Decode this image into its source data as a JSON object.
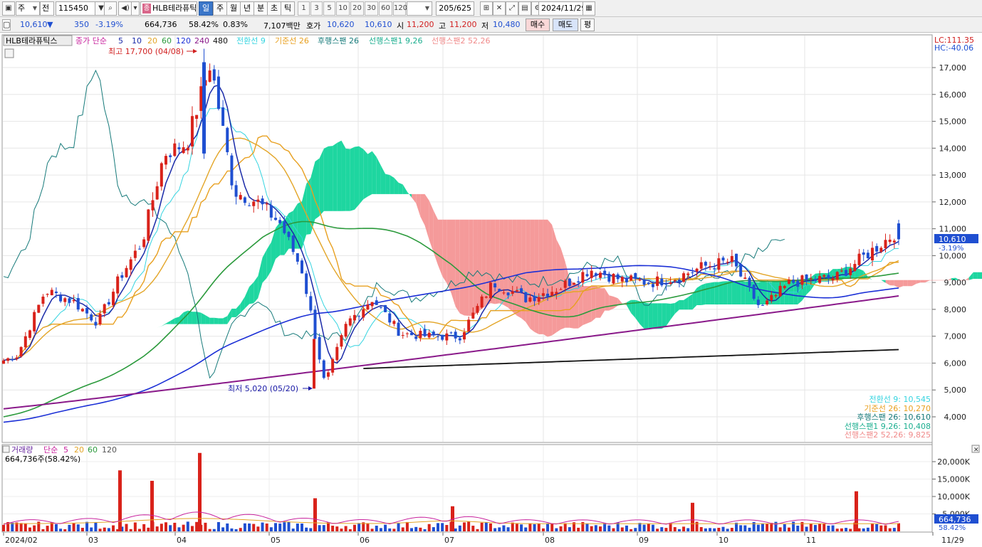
{
  "toolbar": {
    "period_type": "주",
    "market": "전",
    "code": "115450",
    "name": "HLB테라퓨틱",
    "name_tag": "종",
    "periods": [
      "일",
      "주",
      "월",
      "년",
      "분",
      "초",
      "틱"
    ],
    "active_period": "일",
    "numbers": [
      "1",
      "3",
      "5",
      "10",
      "20",
      "30",
      "60",
      "120"
    ],
    "count": "205/625",
    "date": "2024/11/29"
  },
  "quote": {
    "price": "10,610",
    "arrow": "▼",
    "change": "350",
    "change_pct": "-3.19%",
    "volume": "664,736",
    "vol_ratio": "58.42%",
    "turnover_pct": "0.83%",
    "amount": "7,107백만",
    "ask_label": "호가",
    "ask": "10,620",
    "bid": "10,610",
    "open_label": "시",
    "open": "11,200",
    "high_label": "고",
    "high": "11,200",
    "low_label": "저",
    "low": "10,480",
    "buy_label": "매수",
    "sell_label": "매도",
    "eval_label": "평"
  },
  "chart": {
    "name": "HLB테라퓨틱스",
    "ma_label": "종가 단순",
    "ma_periods": [
      "5",
      "10",
      "20",
      "60",
      "120",
      "240",
      "480"
    ],
    "ichimoku": [
      "전환선 9",
      "기준선 26",
      "후행스팬 26",
      "선행스팬1 9,26",
      "선행스팬2 52,26"
    ],
    "lc": "LC:111.35",
    "hc": "HC:-40.06",
    "high_annot": "최고 17,700 (04/08)",
    "low_annot": "최저 5,020 (05/20)",
    "current_price": "10,610",
    "current_pct": "-3.19%",
    "legend": [
      "전환선 9: 10,545",
      "기준선 26: 10,270",
      "후행스팬 26: 10,610",
      "선행스팬1 9,26: 10,408",
      "선행스팬2 52,26: 9,825"
    ],
    "price_ticks": [
      "17,000",
      "16,000",
      "15,000",
      "14,000",
      "13,000",
      "12,000",
      "11,000",
      "10,000",
      "9,000",
      "8,000",
      "7,000",
      "6,000",
      "5,000",
      "4,000"
    ],
    "volume_title": "거래량",
    "volume_ma_label": "단순",
    "volume_ma_periods": [
      "5",
      "20",
      "60",
      "120"
    ],
    "volume_info": "664,736주(58.42%)",
    "volume_current": "664,736",
    "volume_pct": "58.42%",
    "volume_ticks": [
      "20,000K",
      "15,000K",
      "10,000K",
      "5,000K"
    ],
    "x_labels": [
      "2024/02",
      "03",
      "04",
      "05",
      "06",
      "07",
      "08",
      "09",
      "10",
      "11",
      "11/29"
    ],
    "colors": {
      "up": "#d9221a",
      "down": "#1f4fd1",
      "cloud_up": "#1ed6a0",
      "cloud_down": "#f59a9a",
      "conv": "#35d4e0",
      "base": "#e8a020",
      "lag": "#167a7a",
      "ma5": "#1a2aa8",
      "ma20": "#e3a527",
      "ma60": "#2b9a3c",
      "ma120": "#1b2fd6",
      "ma240": "#8a1a8a",
      "ma480": "#111111"
    }
  },
  "chart_data": {
    "type": "candlestick",
    "title": "HLB테라퓨틱스",
    "x": [
      "2024/02",
      "03",
      "04",
      "05",
      "06",
      "07",
      "08",
      "09",
      "10",
      "11",
      "11/29"
    ],
    "ylim": [
      3600,
      17800
    ],
    "high": {
      "value": 17700,
      "date": "04/08"
    },
    "low": {
      "value": 5020,
      "date": "05/20"
    },
    "last": {
      "close": 10610,
      "open": 11200,
      "high": 11200,
      "low": 10480,
      "volume": 664736
    },
    "close_path": [
      {
        "m": "2024/02",
        "v": 6300
      },
      {
        "m": "2024/02",
        "v": 8700
      },
      {
        "m": "2024/02",
        "v": 8300
      },
      {
        "m": "03",
        "v": 7500
      },
      {
        "m": "03",
        "v": 9200
      },
      {
        "m": "03",
        "v": 10500
      },
      {
        "m": "03",
        "v": 13800
      },
      {
        "m": "04",
        "v": 14200
      },
      {
        "m": "04",
        "v": 17200
      },
      {
        "m": "04",
        "v": 12400
      },
      {
        "m": "04",
        "v": 12000
      },
      {
        "m": "05",
        "v": 11200
      },
      {
        "m": "05",
        "v": 9400
      },
      {
        "m": "05",
        "v": 5200
      },
      {
        "m": "05",
        "v": 7500
      },
      {
        "m": "06",
        "v": 8400
      },
      {
        "m": "06",
        "v": 7100
      },
      {
        "m": "06",
        "v": 7000
      },
      {
        "m": "07",
        "v": 7000
      },
      {
        "m": "07",
        "v": 9000
      },
      {
        "m": "07",
        "v": 8400
      },
      {
        "m": "08",
        "v": 8800
      },
      {
        "m": "08",
        "v": 9500
      },
      {
        "m": "08",
        "v": 9100
      },
      {
        "m": "09",
        "v": 9000
      },
      {
        "m": "09",
        "v": 9200
      },
      {
        "m": "09",
        "v": 9600
      },
      {
        "m": "10",
        "v": 9800
      },
      {
        "m": "10",
        "v": 8000
      },
      {
        "m": "10",
        "v": 9000
      },
      {
        "m": "11",
        "v": 9200
      },
      {
        "m": "11",
        "v": 11000
      },
      {
        "m": "11/29",
        "v": 10610
      }
    ],
    "volume_spikes": [
      {
        "m": "03",
        "v": 17500
      },
      {
        "m": "03",
        "v": 14500
      },
      {
        "m": "04",
        "v": 22500
      },
      {
        "m": "05",
        "v": 9500
      },
      {
        "m": "07",
        "v": 7200
      },
      {
        "m": "09",
        "v": 8200
      },
      {
        "m": "11",
        "v": 11500
      }
    ],
    "volume_ylim": [
      0,
      23000
    ]
  }
}
